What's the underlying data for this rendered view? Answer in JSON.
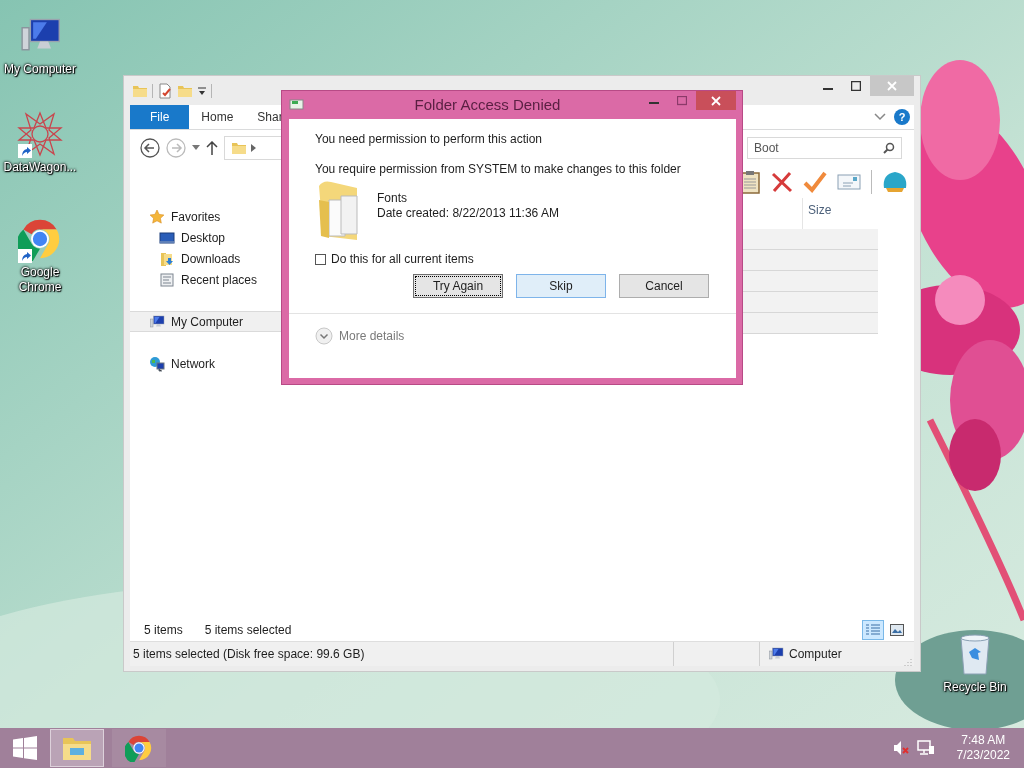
{
  "desktop": {
    "icons": [
      {
        "kind": "computer",
        "label": "My Computer",
        "shortcut": false
      },
      {
        "kind": "star",
        "label": "DataWagon...",
        "shortcut": true
      },
      {
        "kind": "chrome",
        "label": "Google Chrome",
        "shortcut": true
      },
      {
        "kind": "recycle",
        "label": "Recycle Bin",
        "shortcut": false
      }
    ]
  },
  "explorer": {
    "ribbon_tabs": [
      {
        "label": "File",
        "kind": "file"
      },
      {
        "label": "Home",
        "kind": "tab"
      },
      {
        "label": "Shar",
        "kind": "tab"
      }
    ],
    "help": "?",
    "search": {
      "value": "Boot"
    },
    "columns": [
      {
        "label": "Size"
      }
    ],
    "rows": [
      {
        "selected": true
      },
      {
        "selected": true
      },
      {
        "selected": true
      },
      {
        "selected": true
      },
      {
        "selected": true
      }
    ],
    "nav": [
      {
        "label": "Favorites",
        "kind": "star",
        "selected": false,
        "children": [
          {
            "label": "Desktop",
            "kind": "desktop",
            "selected": false
          },
          {
            "label": "Downloads",
            "kind": "downloads",
            "selected": false
          },
          {
            "label": "Recent places",
            "kind": "recent",
            "selected": false
          }
        ]
      },
      {
        "label": "My Computer",
        "kind": "computer",
        "selected": true
      },
      {
        "label": "Network",
        "kind": "network",
        "selected": false
      }
    ],
    "summary": {
      "count": "5 items",
      "selection": "5 items selected"
    },
    "views": [
      {
        "kind": "details",
        "selected": true
      },
      {
        "kind": "large_icons",
        "selected": false
      }
    ],
    "status_bar": {
      "text": "5 items selected (Disk free space: 99.6 GB)",
      "location": "Computer"
    }
  },
  "dialog": {
    "title": "Folder Access Denied",
    "heading": "You need permission to perform this action",
    "message": "You require permission from SYSTEM to make changes to this folder",
    "item": {
      "name": "Fonts",
      "date": "Date created: 8/22/2013 11:36 AM"
    },
    "apply_all": {
      "label": "Do this for all current items",
      "checked": false
    },
    "buttons": [
      {
        "label": "Try Again",
        "focused": true,
        "highlighted": false
      },
      {
        "label": "Skip",
        "focused": false,
        "highlighted": true
      },
      {
        "label": "Cancel",
        "focused": false,
        "highlighted": false
      }
    ],
    "more_details": "More details"
  },
  "taskbar": {
    "apps": [
      {
        "kind": "explorer",
        "selected": true
      },
      {
        "kind": "chrome",
        "selected": false
      }
    ],
    "tray": {
      "muted": true
    },
    "clock": {
      "time": "7:48 AM",
      "date": "7/23/2022"
    }
  }
}
